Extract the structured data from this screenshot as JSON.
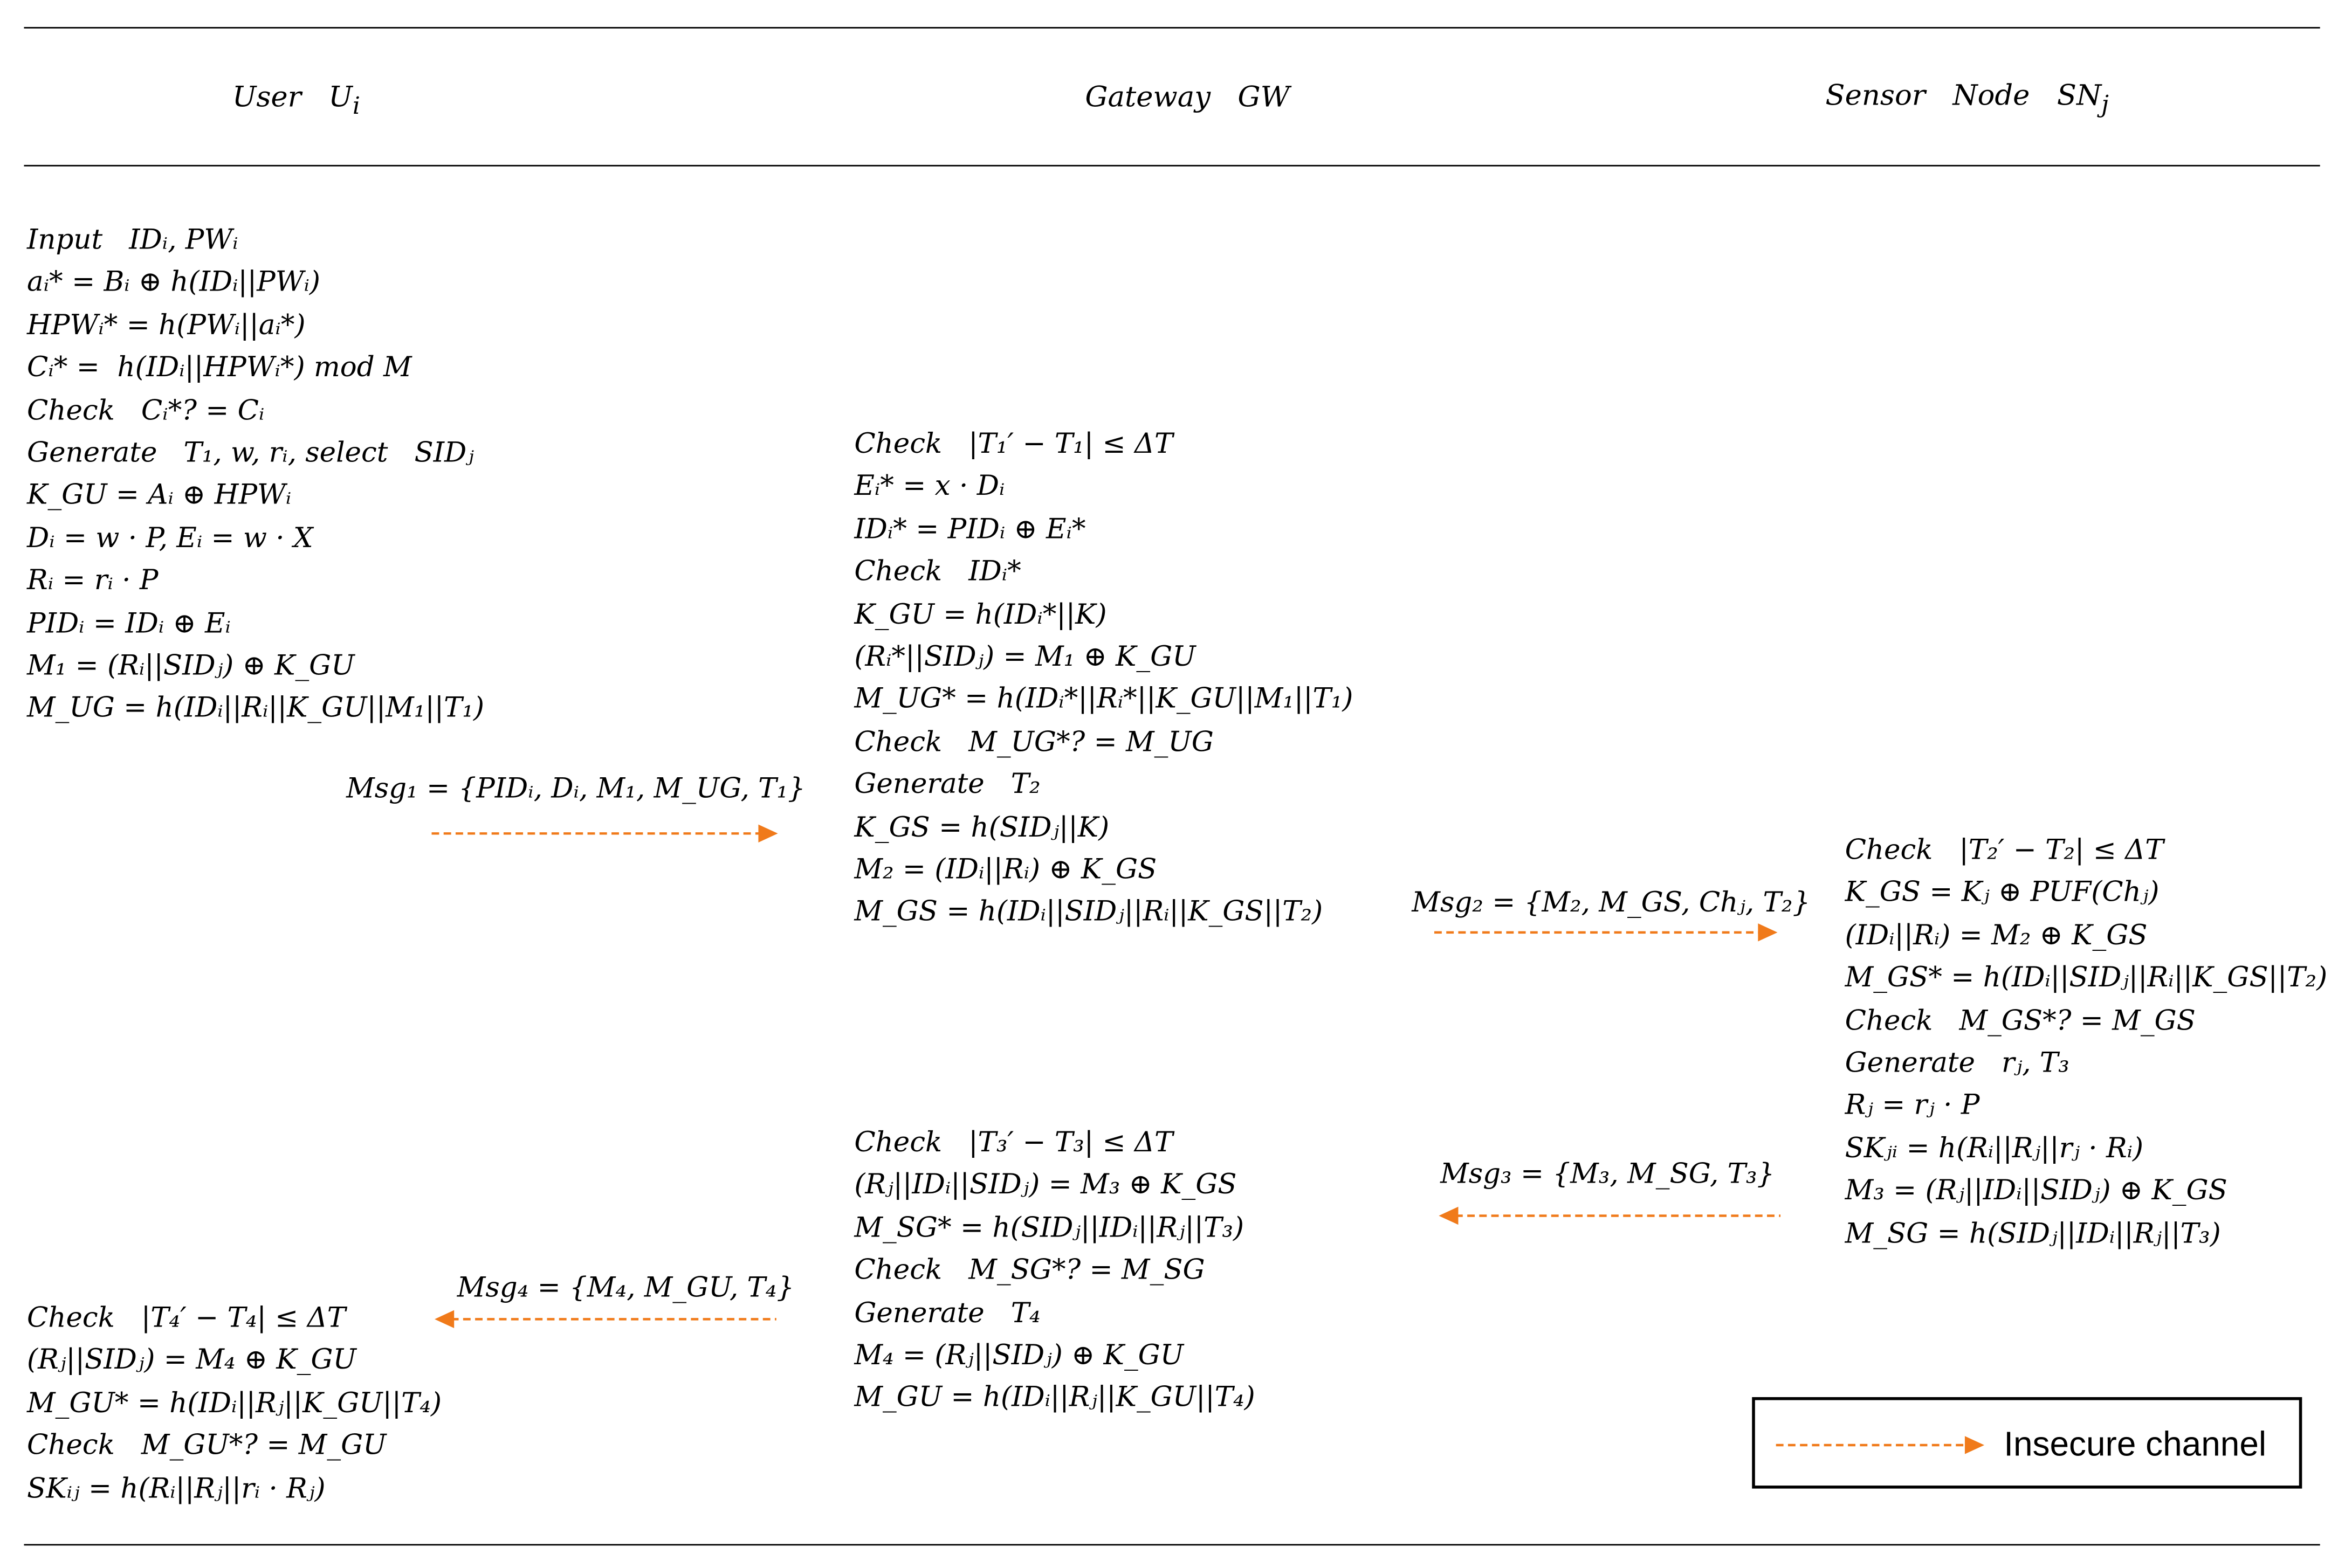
{
  "headers": {
    "user": "User   U",
    "user_sub": "i",
    "gateway": "Gateway   GW",
    "sensor": "Sensor   Node   SN",
    "sensor_sub": "j"
  },
  "user_block_1": [
    "Input   IDᵢ, PWᵢ",
    "aᵢ* = Bᵢ ⊕ h(IDᵢ||PWᵢ)",
    "HPWᵢ* = h(PWᵢ||aᵢ*)",
    "Cᵢ* =  h(IDᵢ||HPWᵢ*) mod M",
    "Check   Cᵢ*? = Cᵢ",
    "Generate   T₁, w, rᵢ, select   SIDⱼ",
    "K_GU = Aᵢ ⊕ HPWᵢ",
    "Dᵢ = w · P, Eᵢ = w · X",
    "Rᵢ = rᵢ · P",
    "PIDᵢ = IDᵢ ⊕ Eᵢ",
    "M₁ = (Rᵢ||SIDⱼ) ⊕ K_GU",
    "M_UG = h(IDᵢ||Rᵢ||K_GU||M₁||T₁)"
  ],
  "gateway_block_1": [
    "Check   |T₁′ − T₁| ≤ ΔT",
    "Eᵢ* = x · Dᵢ",
    "IDᵢ* = PIDᵢ ⊕ Eᵢ*",
    "Check   IDᵢ*",
    "K_GU = h(IDᵢ*||K)",
    "(Rᵢ*||SIDⱼ) = M₁ ⊕ K_GU",
    "M_UG* = h(IDᵢ*||Rᵢ*||K_GU||M₁||T₁)",
    "Check   M_UG*? = M_UG",
    "Generate   T₂",
    "K_GS = h(SIDⱼ||K)",
    "M₂ = (IDᵢ||Rᵢ) ⊕ K_GS",
    "M_GS = h(IDᵢ||SIDⱼ||Rᵢ||K_GS||T₂)"
  ],
  "sensor_block": [
    "Check   |T₂′ − T₂| ≤ ΔT",
    "K_GS = Kⱼ ⊕ PUF(Chⱼ)",
    "(IDᵢ||Rᵢ) = M₂ ⊕ K_GS",
    "M_GS* = h(IDᵢ||SIDⱼ||Rᵢ||K_GS||T₂)",
    "Check   M_GS*? = M_GS",
    "Generate   rⱼ, T₃",
    "Rⱼ = rⱼ · P",
    "SKⱼᵢ = h(Rᵢ||Rⱼ||rⱼ · Rᵢ)",
    "M₃ = (Rⱼ||IDᵢ||SIDⱼ) ⊕ K_GS",
    "M_SG = h(SIDⱼ||IDᵢ||Rⱼ||T₃)"
  ],
  "gateway_block_2": [
    "Check   |T₃′ − T₃| ≤ ΔT",
    "(Rⱼ||IDᵢ||SIDⱼ) = M₃ ⊕ K_GS",
    "M_SG* = h(SIDⱼ||IDᵢ||Rⱼ||T₃)",
    "Check   M_SG*? = M_SG",
    "Generate   T₄",
    "M₄ = (Rⱼ||SIDⱼ) ⊕ K_GU",
    "M_GU = h(IDᵢ||Rⱼ||K_GU||T₄)"
  ],
  "user_block_2": [
    "Check   |T₄′ − T₄| ≤ ΔT",
    "(Rⱼ||SIDⱼ) = M₄ ⊕ K_GU",
    "M_GU* = h(IDᵢ||Rⱼ||K_GU||T₄)",
    "Check   M_GU*? = M_GU",
    "SKᵢⱼ = h(Rᵢ||Rⱼ||rᵢ · Rⱼ)"
  ],
  "messages": {
    "msg1": "Msg₁ = {PIDᵢ, Dᵢ, M₁, M_UG, T₁}",
    "msg2": "Msg₂ = {M₂, M_GS, Chⱼ, T₂}",
    "msg3": "Msg₃ = {M₃, M_SG, T₃}",
    "msg4": "Msg₄ = {M₄, M_GU, T₄}"
  },
  "legend": {
    "label": "Insecure channel"
  },
  "colors": {
    "arrow": "#f07a1a",
    "rule": "#000000"
  }
}
